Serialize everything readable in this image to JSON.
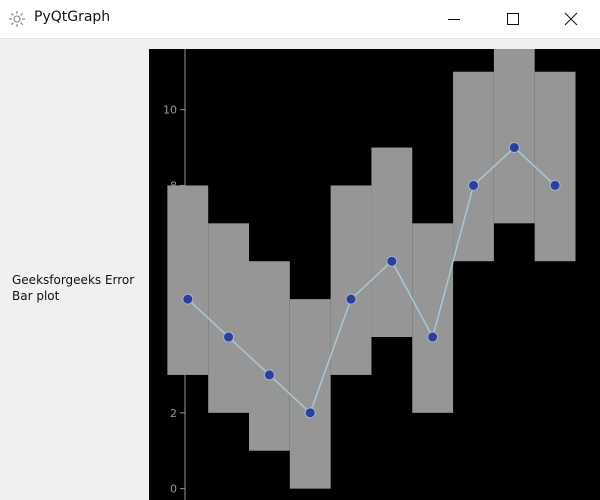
{
  "window": {
    "title": "PyQtGraph",
    "app_icon": "pyqtgraph-gear-icon",
    "controls": {
      "minimize": "minimize-icon",
      "maximize": "maximize-icon",
      "close": "close-icon"
    }
  },
  "label": {
    "text": "Geeksforgeeks Error Bar plot"
  },
  "colors": {
    "plot_background": "#000000",
    "bar_fill": "#969696",
    "line": "#a8c8d8",
    "point_fill": "#2e3f9a",
    "point_stroke": "#9fb4d4",
    "axis": "#969696"
  },
  "chart_data": {
    "type": "bar",
    "x": [
      1,
      2,
      3,
      4,
      5,
      6,
      7,
      8,
      9,
      10
    ],
    "values": [
      5,
      4,
      3,
      2,
      5,
      6,
      4,
      8,
      9,
      8
    ],
    "error_bar": {
      "bottom": [
        2,
        2,
        2,
        2,
        2,
        2,
        2,
        2,
        2,
        2
      ],
      "top": [
        3,
        3,
        3,
        3,
        3,
        3,
        3,
        3,
        3,
        3
      ]
    },
    "bar_width": 1,
    "line": {
      "x": [
        1,
        2,
        3,
        4,
        5,
        6,
        7,
        8,
        9,
        10
      ],
      "y": [
        5,
        4,
        3,
        2,
        5,
        6,
        4,
        8,
        9,
        8
      ]
    },
    "yticks": [
      "0",
      "2",
      "4",
      "6",
      "8",
      "10"
    ],
    "ytick_values": [
      0,
      2,
      4,
      6,
      8,
      10
    ],
    "xlim": [
      0.05,
      11.1
    ],
    "ylim": [
      -0.3,
      11.6
    ],
    "grid": false,
    "title": "",
    "xlabel": "",
    "ylabel": ""
  }
}
